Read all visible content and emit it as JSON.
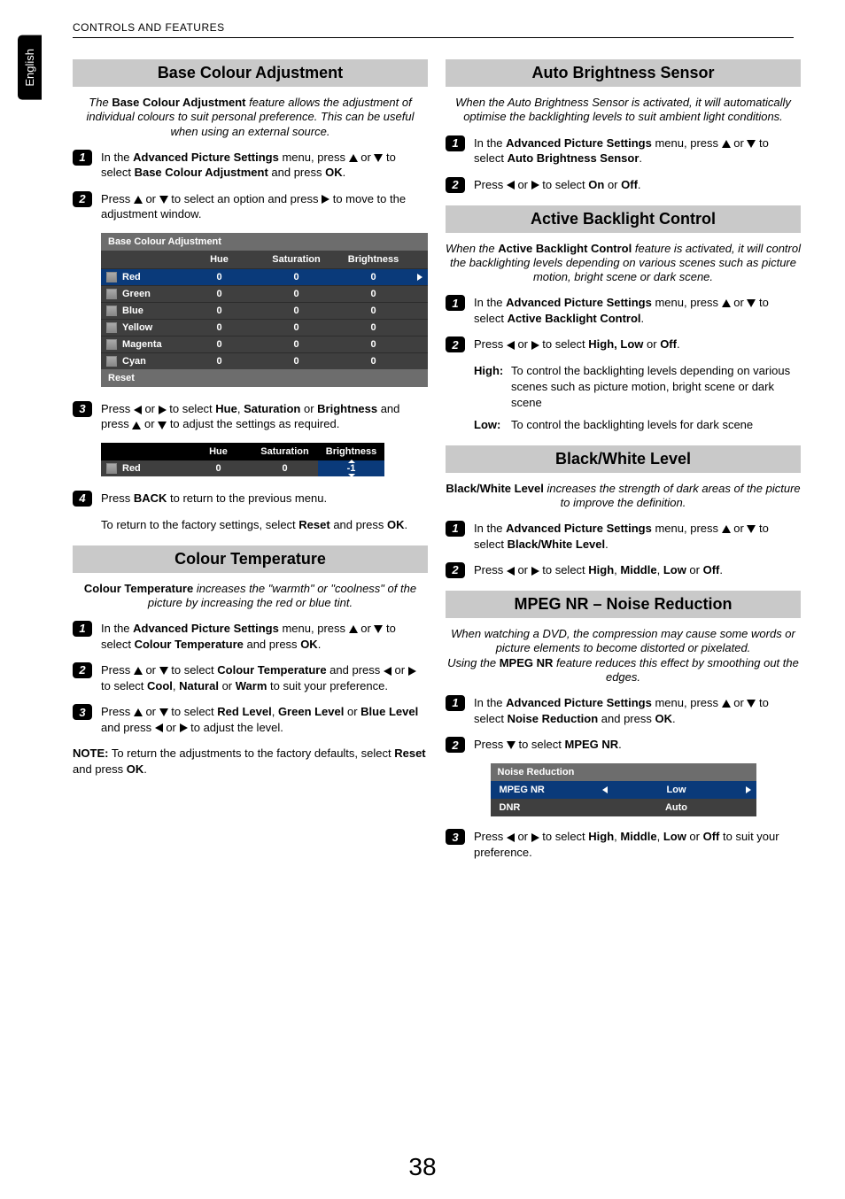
{
  "language_tab": "English",
  "header": "CONTROLS AND FEATURES",
  "page_number": "38",
  "left": {
    "s1": {
      "title": "Base Colour Adjustment",
      "intro_pre": "The ",
      "intro_bold": "Base Colour Adjustment",
      "intro_post": " feature allows the adjustment of individual colours to suit personal preference. This can be useful when using an external source.",
      "step1_a": "In the ",
      "step1_b": "Advanced Picture Settings",
      "step1_c": " menu, press ",
      "step1_d": " or ",
      "step1_e": " to select ",
      "step1_f": "Base Colour Adjustment",
      "step1_g": " and press ",
      "step1_h": "OK",
      "step1_i": ".",
      "step2_a": "Press ",
      "step2_b": " or ",
      "step2_c": " to select an option and press ",
      "step2_d": " to move to the adjustment window.",
      "osd1": {
        "title": "Base Colour Adjustment",
        "cols": [
          "Hue",
          "Saturation",
          "Brightness"
        ],
        "rows": [
          {
            "name": "Red",
            "v": [
              "0",
              "0",
              "0"
            ],
            "sel": true
          },
          {
            "name": "Green",
            "v": [
              "0",
              "0",
              "0"
            ]
          },
          {
            "name": "Blue",
            "v": [
              "0",
              "0",
              "0"
            ]
          },
          {
            "name": "Yellow",
            "v": [
              "0",
              "0",
              "0"
            ]
          },
          {
            "name": "Magenta",
            "v": [
              "0",
              "0",
              "0"
            ]
          },
          {
            "name": "Cyan",
            "v": [
              "0",
              "0",
              "0"
            ]
          }
        ],
        "reset": "Reset"
      },
      "step3_a": "Press ",
      "step3_b": " or ",
      "step3_c": " to select ",
      "step3_d": "Hue",
      "step3_e": ", ",
      "step3_f": "Saturation",
      "step3_g": " or ",
      "step3_h": "Brightness",
      "step3_i": " and press ",
      "step3_j": " or ",
      "step3_k": " to adjust the settings as required.",
      "osd2": {
        "cols": [
          "Hue",
          "Saturation",
          "Brightness"
        ],
        "row": {
          "name": "Red",
          "v": [
            "0",
            "0",
            "-1"
          ]
        }
      },
      "step4_a": "Press ",
      "step4_b": "BACK",
      "step4_c": " to return to the previous menu.",
      "step4x_a": "To return to the factory settings, select ",
      "step4x_b": "Reset",
      "step4x_c": " and press ",
      "step4x_d": "OK",
      "step4x_e": "."
    },
    "s2": {
      "title": "Colour Temperature",
      "intro_b": "Colour Temperature",
      "intro_post": " increases the \"warmth\" or \"coolness\" of the picture by increasing the red or blue tint.",
      "step1_a": "In the ",
      "step1_b": "Advanced Picture Settings",
      "step1_c": " menu, press ",
      "step1_d": " or ",
      "step1_e": " to select ",
      "step1_f": "Colour Temperature",
      "step1_g": " and press ",
      "step1_h": "OK",
      "step1_i": ".",
      "step2_a": "Press ",
      "step2_b": " or ",
      "step2_c": " to select ",
      "step2_d": "Colour Temperature",
      "step2_e": " and press ",
      "step2_f": " or ",
      "step2_g": " to select ",
      "step2_h": "Cool",
      "step2_i": ", ",
      "step2_j": "Natural",
      "step2_k": " or ",
      "step2_l": "Warm",
      "step2_m": " to suit your preference.",
      "step3_a": "Press ",
      "step3_b": " or ",
      "step3_c": " to select ",
      "step3_d": "Red Level",
      "step3_e": ", ",
      "step3_f": "Green Level",
      "step3_g": " or ",
      "step3_h": "Blue Level",
      "step3_i": " and press ",
      "step3_j": " or ",
      "step3_k": " to adjust the level.",
      "note_a": "NOTE:",
      "note_b": " To return the adjustments to the factory defaults, select ",
      "note_c": "Reset",
      "note_d": " and press ",
      "note_e": "OK",
      "note_f": "."
    }
  },
  "right": {
    "s1": {
      "title": "Auto Brightness Sensor",
      "intro": "When the Auto Brightness Sensor is activated, it will automatically optimise the backlighting levels to suit ambient light conditions.",
      "step1_a": "In the ",
      "step1_b": "Advanced Picture Settings",
      "step1_c": " menu, press ",
      "step1_d": " or ",
      "step1_e": " to select ",
      "step1_f": "Auto Brightness Sensor",
      "step1_g": ".",
      "step2_a": "Press ",
      "step2_b": " or ",
      "step2_c": " to select ",
      "step2_d": "On",
      "step2_e": " or ",
      "step2_f": "Off",
      "step2_g": "."
    },
    "s2": {
      "title": "Active Backlight Control",
      "intro_a": "When the ",
      "intro_b": "Active Backlight Control",
      "intro_c": " feature is activated, it will control the backlighting levels depending on various scenes such as  picture motion, bright scene or dark scene.",
      "step1_a": "In the ",
      "step1_b": "Advanced Picture Settings",
      "step1_c": " menu, press ",
      "step1_d": " or ",
      "step1_e": " to select ",
      "step1_f": "Active Backlight Control",
      "step1_g": ".",
      "step2_a": "Press ",
      "step2_b": " or ",
      "step2_c": " to select ",
      "step2_d": "High, Low",
      "step2_e": " or ",
      "step2_f": "Off",
      "step2_g": ".",
      "high_k": "High:",
      "high_v": "To control the backlighting levels depending on various scenes such as picture motion, bright scene or dark scene",
      "low_k": "Low:",
      "low_v": "To control the backlighting levels for dark scene"
    },
    "s3": {
      "title": "Black/White Level",
      "intro_b": "Black/White Level",
      "intro_post": " increases the strength of dark areas of the picture to improve the definition.",
      "step1_a": "In the ",
      "step1_b": "Advanced Picture Settings",
      "step1_c": " menu, press ",
      "step1_d": " or ",
      "step1_e": " to select ",
      "step1_f": "Black/White Level",
      "step1_g": ".",
      "step2_a": "Press ",
      "step2_b": " or ",
      "step2_c": " to select ",
      "step2_d": "High",
      "step2_e": ", ",
      "step2_f": "Middle",
      "step2_g": ", ",
      "step2_h": "Low",
      "step2_i": " or ",
      "step2_j": "Off",
      "step2_k": "."
    },
    "s4": {
      "title": "MPEG NR – Noise Reduction",
      "intro_a": "When watching a DVD, the compression may cause some words or picture elements to become distorted or pixelated.",
      "intro_b_pre": "Using the ",
      "intro_b_bold": "MPEG NR",
      "intro_b_post": " feature reduces this effect by smoothing out the edges.",
      "step1_a": "In the ",
      "step1_b": "Advanced Picture Settings",
      "step1_c": " menu, press ",
      "step1_d": " or ",
      "step1_e": " to select ",
      "step1_f": "Noise Reduction",
      "step1_g": " and press ",
      "step1_h": "OK",
      "step1_i": ".",
      "step2_a": "Press ",
      "step2_b": " to select ",
      "step2_c": "MPEG NR",
      "step2_d": ".",
      "osd": {
        "title": "Noise Reduction",
        "rows": [
          {
            "name": "MPEG NR",
            "value": "Low",
            "sel": true
          },
          {
            "name": "DNR",
            "value": "Auto"
          }
        ]
      },
      "step3_a": "Press ",
      "step3_b": " or ",
      "step3_c": " to select ",
      "step3_d": "High",
      "step3_e": ", ",
      "step3_f": "Middle",
      "step3_g": ", ",
      "step3_h": "Low",
      "step3_i": " or ",
      "step3_j": "Off",
      "step3_k": " to suit your preference."
    }
  }
}
